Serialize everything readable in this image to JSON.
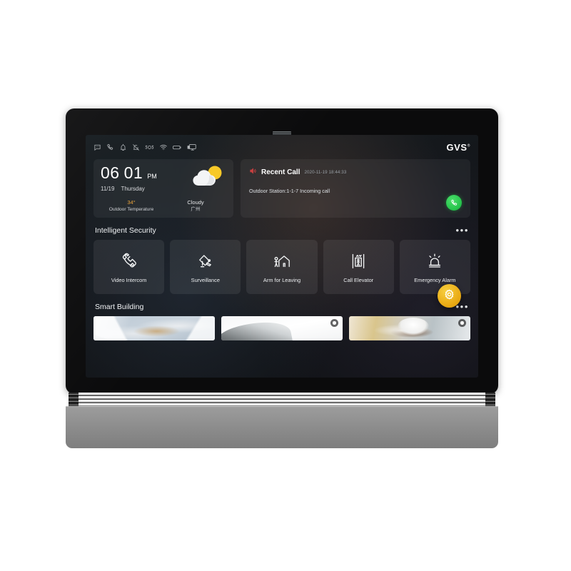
{
  "device": {
    "name": "GVS Smart Home Indoor Monitor",
    "brand": "GVS",
    "brand_mark": "®"
  },
  "statusbar": {
    "icons": [
      {
        "name": "message-icon",
        "label": "Messages"
      },
      {
        "name": "phone-icon",
        "label": "Phone"
      },
      {
        "name": "alarm-bell-icon",
        "label": "Alarm"
      },
      {
        "name": "bell-muted-icon",
        "label": "Do Not Disturb"
      },
      {
        "name": "sos-icon",
        "label": "SOS"
      },
      {
        "name": "wifi-icon",
        "label": "Wi-Fi"
      },
      {
        "name": "battery-icon",
        "label": "Battery"
      },
      {
        "name": "monitor-icon",
        "label": "Display"
      }
    ]
  },
  "weather": {
    "hour": "06",
    "minute": "01",
    "ampm": "PM",
    "date": "11/19",
    "weekday": "Thursday",
    "temperature": "34°",
    "temperature_label": "Outdoor Temperature",
    "condition": "Cloudy",
    "city": "广州",
    "icon": "cloudy-sun-icon",
    "accent_color": "#e8a33a"
  },
  "recent_call": {
    "title": "Recent Call",
    "timestamp": "2020-11-19 18:44:33",
    "message": "Outdoor Station:1-1-7 Incoming call",
    "speaker_icon": "speaker-red-icon",
    "answer_icon": "phone-answer-icon",
    "answer_color": "#24c24a",
    "speaker_color": "#c94040"
  },
  "sections": [
    {
      "title": "Intelligent Security",
      "more_label": "•••",
      "tiles": [
        {
          "label": "Video Intercom",
          "icon": "phone-handset-icon"
        },
        {
          "label": "Surveillance",
          "icon": "cctv-camera-icon"
        },
        {
          "label": "Arm for Leaving",
          "icon": "house-person-icon"
        },
        {
          "label": "Call Elevator",
          "icon": "elevator-icon"
        },
        {
          "label": "Emergency Alarm",
          "icon": "siren-icon"
        }
      ]
    },
    {
      "title": "Smart Building",
      "more_label": "•••",
      "cards": [
        {
          "name": "card-floorplan",
          "badge": false
        },
        {
          "name": "card-device",
          "badge": true
        },
        {
          "name": "card-lifestyle",
          "badge": true
        }
      ]
    }
  ],
  "fab": {
    "icon": "gear-icon",
    "label": "Settings",
    "color": "#eaab15"
  }
}
